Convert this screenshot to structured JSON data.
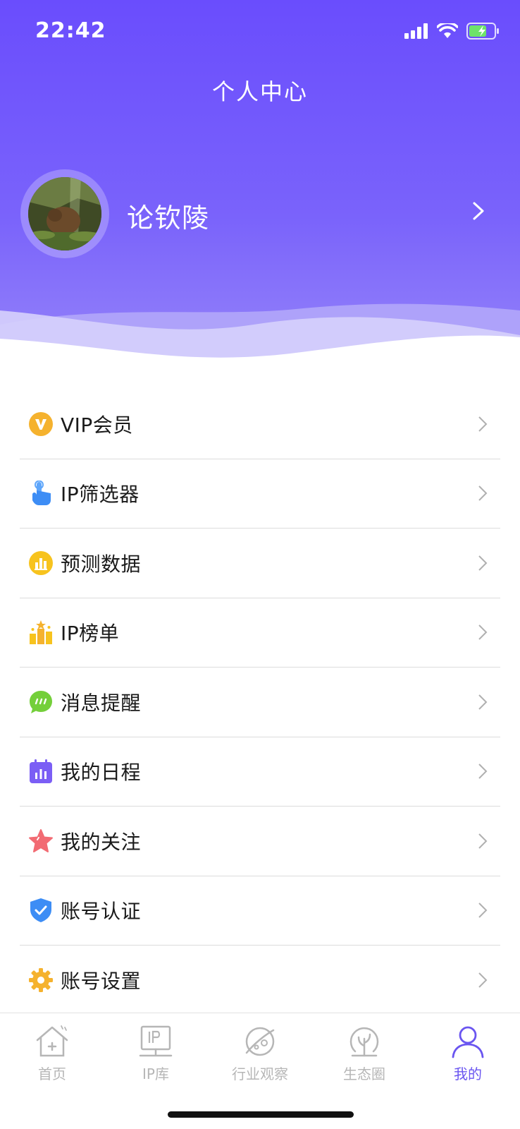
{
  "status_bar": {
    "time": "22:42"
  },
  "header": {
    "title": "个人中心",
    "username": "论钦陵"
  },
  "menu": [
    {
      "label": "VIP会员",
      "icon": "vip-icon",
      "color": "#f5b22e"
    },
    {
      "label": "IP筛选器",
      "icon": "tap-finger-icon",
      "color": "#3d8df5"
    },
    {
      "label": "预测数据",
      "icon": "bar-chart-icon",
      "color": "#f7c31e"
    },
    {
      "label": "IP榜单",
      "icon": "ranking-icon",
      "color": "#f7c31e"
    },
    {
      "label": "消息提醒",
      "icon": "message-icon",
      "color": "#74cf3a"
    },
    {
      "label": "我的日程",
      "icon": "calendar-icon",
      "color": "#7b5ef5"
    },
    {
      "label": "我的关注",
      "icon": "star-icon",
      "color": "#f26b73"
    },
    {
      "label": "账号认证",
      "icon": "shield-check-icon",
      "color": "#3d8df5"
    },
    {
      "label": "账号设置",
      "icon": "gear-icon",
      "color": "#f5b22e"
    }
  ],
  "tabbar": [
    {
      "label": "首页",
      "icon": "home-icon",
      "active": false
    },
    {
      "label": "IP库",
      "icon": "ip-library-icon",
      "active": false
    },
    {
      "label": "行业观察",
      "icon": "planet-icon",
      "active": false
    },
    {
      "label": "生态圈",
      "icon": "tree-icon",
      "active": false
    },
    {
      "label": "我的",
      "icon": "user-icon",
      "active": true
    }
  ],
  "colors": {
    "accent": "#6a55f0",
    "header_top": "#6a4dfd",
    "inactive_tab": "#b6b6b6"
  }
}
